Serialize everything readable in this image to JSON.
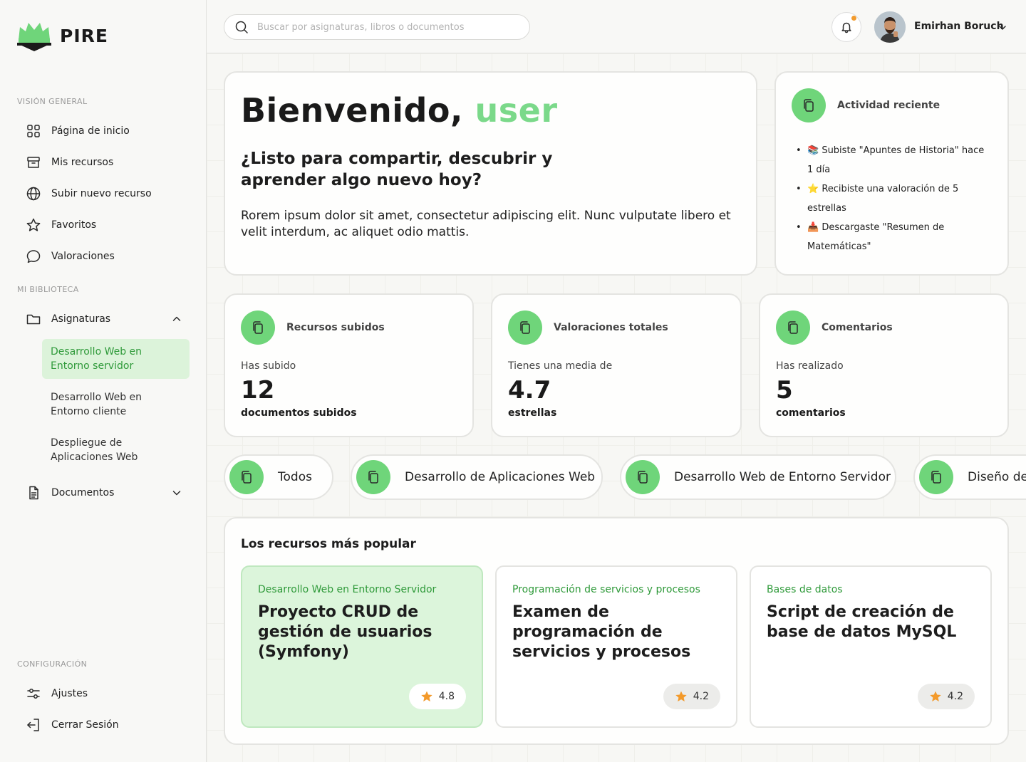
{
  "brand": {
    "name": "PIRE",
    "accent": "#6fd57a"
  },
  "sidebar": {
    "section_overview": "VISIÓN GENERAL",
    "nav": [
      {
        "label": "Página de inicio",
        "icon": "grid-icon"
      },
      {
        "label": "Mis recursos",
        "icon": "archive-icon"
      },
      {
        "label": "Subir nuevo recurso",
        "icon": "globe-icon"
      },
      {
        "label": "Favoritos",
        "icon": "star-icon"
      },
      {
        "label": "Valoraciones",
        "icon": "chat-bubble-icon"
      }
    ],
    "section_library": "MI BIBLIOTECA",
    "subjects_label": "Asignaturas",
    "subjects": [
      {
        "label": "Desarrollo Web en Entorno servidor",
        "active": true
      },
      {
        "label": "Desarrollo Web en Entorno cliente",
        "active": false
      },
      {
        "label": "Despliegue de Aplicaciones Web",
        "active": false
      }
    ],
    "documents_label": "Documentos",
    "section_config": "CONFIGURACIÓN",
    "settings_label": "Ajustes",
    "logout_label": "Cerrar Sesión"
  },
  "topbar": {
    "search_placeholder": "Buscar por asignaturas, libros o documentos",
    "user_name": "Emirhan Boruch",
    "has_notification": true
  },
  "welcome": {
    "greeting": "Bienvenido,",
    "username": "user",
    "subtitle": "¿Listo para compartir, descubrir y aprender algo nuevo hoy?",
    "body": "Rorem ipsum dolor sit amet, consectetur adipiscing elit. Nunc vulputate libero et velit interdum, ac aliquet odio mattis."
  },
  "activity": {
    "title": "Actividad reciente",
    "items": [
      "📚 Subiste \"Apuntes de Historia\" hace 1 día",
      "⭐ Recibiste una valoración de 5 estrellas",
      "📥 Descargaste \"Resumen de Matemáticas\""
    ]
  },
  "stats": [
    {
      "title": "Recursos subidos",
      "pre": "Has subido",
      "value": "12",
      "unit": "documentos subidos"
    },
    {
      "title": "Valoraciones totales",
      "pre": "Tienes una media de",
      "value": "4.7",
      "unit": "estrellas"
    },
    {
      "title": "Comentarios",
      "pre": "Has realizado",
      "value": "5",
      "unit": "comentarios"
    }
  ],
  "filters": [
    "Todos",
    "Desarrollo de Aplicaciones Web",
    "Desarrollo Web de Entorno Servidor",
    "Diseño de"
  ],
  "popular": {
    "title": "Los recursos más popular",
    "items": [
      {
        "category": "Desarrollo Web en Entorno Servidor",
        "title": "Proyecto CRUD de gestión de usuarios (Symfony)",
        "rating": "4.8",
        "highlighted": true
      },
      {
        "category": "Programación de servicios y procesos",
        "title": "Examen de programación de servicios y procesos",
        "rating": "4.2",
        "highlighted": false
      },
      {
        "category": "Bases de datos",
        "title": "Script de creación de base de datos MySQL",
        "rating": "4.2",
        "highlighted": false
      }
    ]
  }
}
